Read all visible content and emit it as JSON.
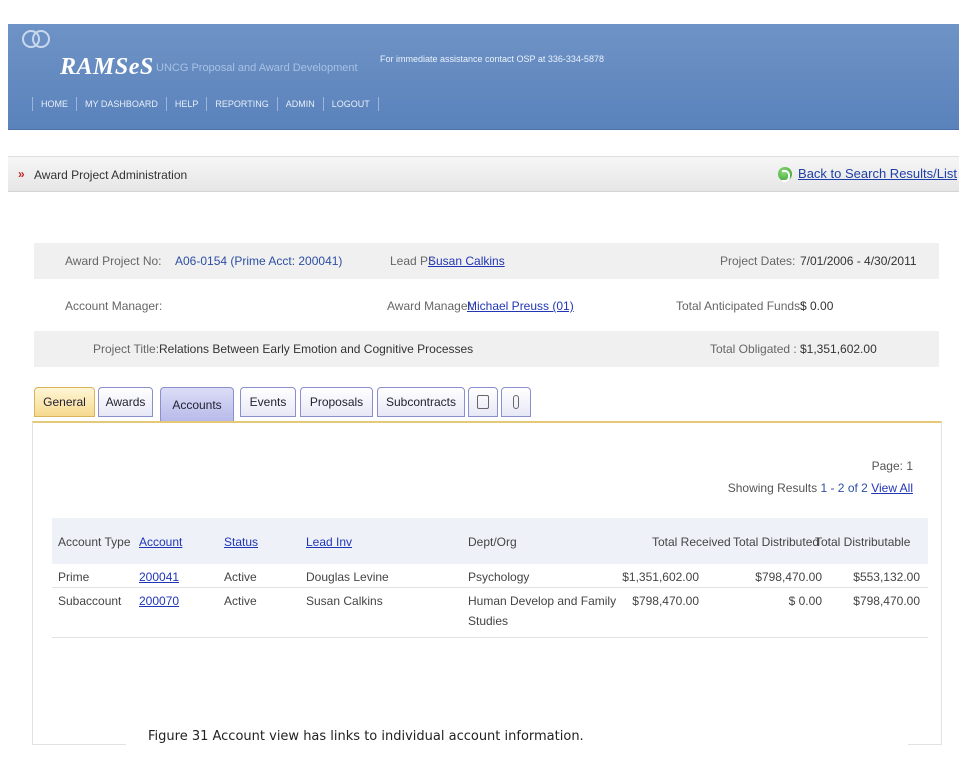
{
  "app": {
    "logo": "RAMSeS",
    "tagline": "UNCG Proposal and Award Development",
    "assist": "For immediate assistance contact OSP at 336-334-5878",
    "nav": [
      "HOME",
      "MY DASHBOARD",
      "HELP",
      "REPORTING",
      "ADMIN",
      "LOGOUT"
    ]
  },
  "titlebar": {
    "arrows": "»",
    "title": "Award Project Administration",
    "back_label": "Back to Search Results/List"
  },
  "project": {
    "award_no_label": "Award Project No:",
    "award_no": "A06-0154 (Prime Acct: 200041)",
    "lead_pi_label": "Lead PI:",
    "lead_pi": "Susan Calkins",
    "dates_label": "Project Dates:",
    "dates": "7/01/2006 - 4/30/2011",
    "account_manager_label": "Account Manager:",
    "award_manager_label": "Award Manager:",
    "award_manager": "Michael Preuss (01)",
    "anticipated_label": "Total Anticipated Funds:",
    "anticipated": "$ 0.00",
    "title_label": "Project Title:",
    "title": "Relations Between Early Emotion and Cognitive Processes",
    "obligated_label": "Total Obligated :",
    "obligated": "$1,351,602.00"
  },
  "tabs": [
    "General",
    "Awards",
    "Accounts",
    "Events",
    "Proposals",
    "Subcontracts"
  ],
  "paging": {
    "page_label": "Page:",
    "page": "1",
    "showing_label": "Showing Results",
    "range": "1 - 2 of 2",
    "view_all": "View All"
  },
  "table": {
    "headers": [
      "Account Type",
      "Account",
      "Status",
      "Lead Inv",
      "Dept/Org",
      "Total Received",
      "Total Distributed",
      "Total Distributable"
    ],
    "rows": [
      {
        "type": "Prime",
        "account": "200041",
        "status": "Active",
        "lead": "Douglas Levine",
        "dept": "Psychology",
        "dept2": "",
        "received": "$1,351,602.00",
        "distributed": "$798,470.00",
        "distributable": "$553,132.00"
      },
      {
        "type": "Subaccount",
        "account": "200070",
        "status": "Active",
        "lead": "Susan Calkins",
        "dept": "Human Develop and Family",
        "dept2": "Studies",
        "received": "$798,470.00",
        "distributed": "$ 0.00",
        "distributable": "$798,470.00"
      }
    ]
  },
  "caption": "Figure 31 Account view has links to individual account information.",
  "icons": {
    "back": "green-circular-arrow-icon",
    "tab_extra_1": "document-icon",
    "tab_extra_2": "paperclip-icon"
  },
  "colors": {
    "header_bg": "#5a82bb",
    "link": "#2136b5",
    "accent_red": "#c0282c",
    "general_tab": "#f6d98e"
  }
}
